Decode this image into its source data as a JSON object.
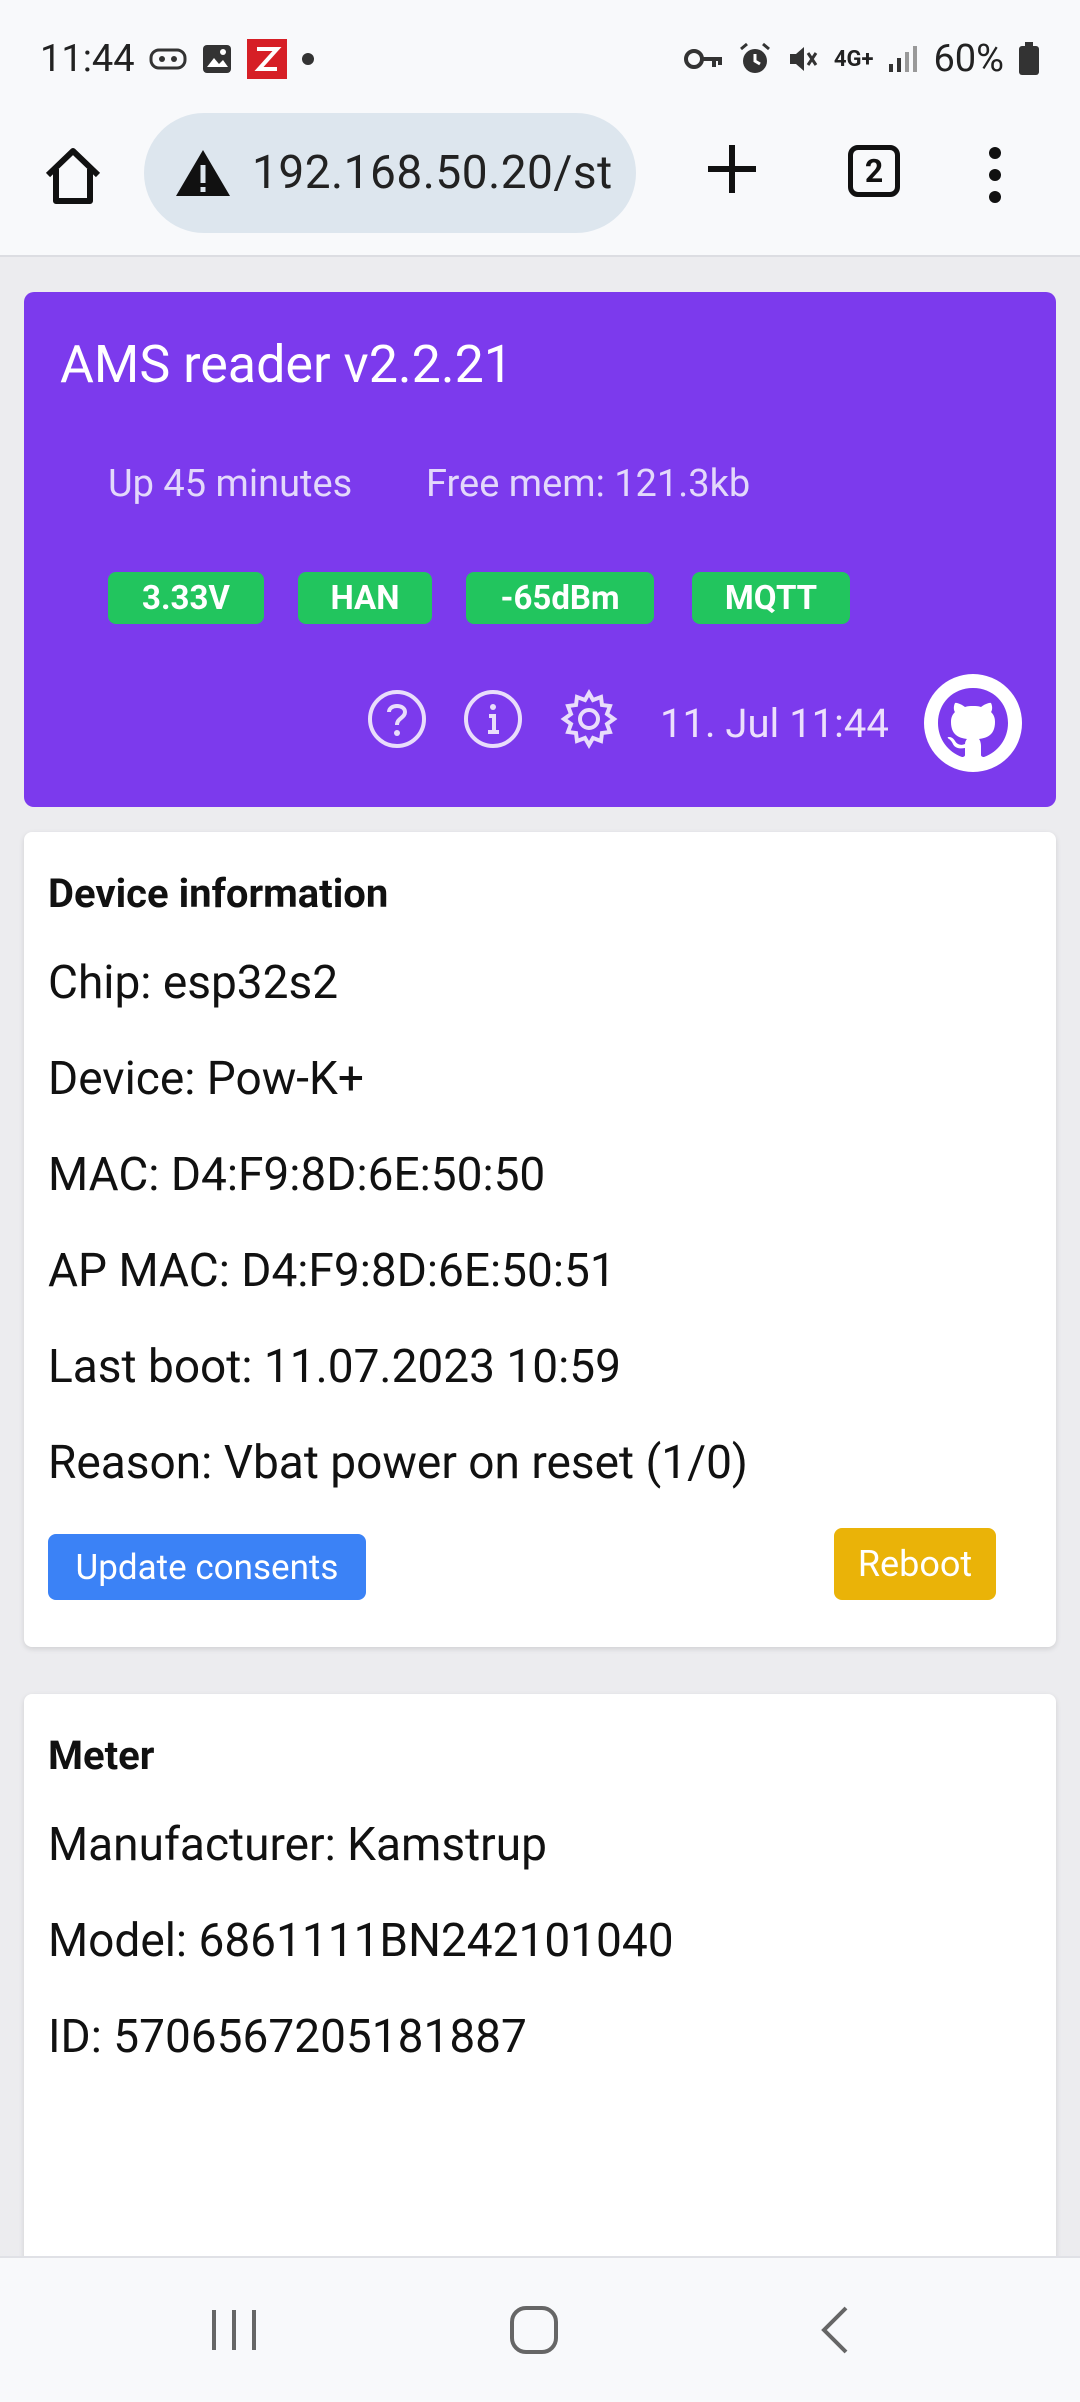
{
  "status_bar": {
    "time": "11:44",
    "battery": "60%",
    "network": "4G+"
  },
  "browser": {
    "url": "192.168.50.20/st",
    "tab_count": "2"
  },
  "header": {
    "title": "AMS reader v2.2.21",
    "uptime": "Up 45 minutes",
    "free_mem": "Free mem: 121.3kb",
    "badges": [
      "3.33V",
      "HAN",
      "-65dBm",
      "MQTT"
    ],
    "date": "11. Jul 11:44",
    "accent_color": "#7c3aed",
    "badge_color": "#22c55e"
  },
  "device_info": {
    "title": "Device information",
    "lines": [
      "Chip: esp32s2",
      "Device: Pow-K+",
      "MAC: D4:F9:8D:6E:50:50",
      "AP MAC: D4:F9:8D:6E:50:51",
      "Last boot: 11.07.2023 10:59",
      "Reason: Vbat power on reset (1/0)"
    ],
    "update_consents_label": "Update consents",
    "reboot_label": "Reboot"
  },
  "meter": {
    "title": "Meter",
    "lines": [
      "Manufacturer: Kamstrup",
      "Model: 6861111BN242101040",
      "ID: 5706567205181887"
    ]
  },
  "icons": {
    "home": "home-icon",
    "warning": "warning-icon",
    "plus": "plus-icon",
    "menu": "more-vert-icon",
    "help": "help-icon",
    "info": "info-icon",
    "settings": "gear-icon",
    "github": "github-icon"
  }
}
